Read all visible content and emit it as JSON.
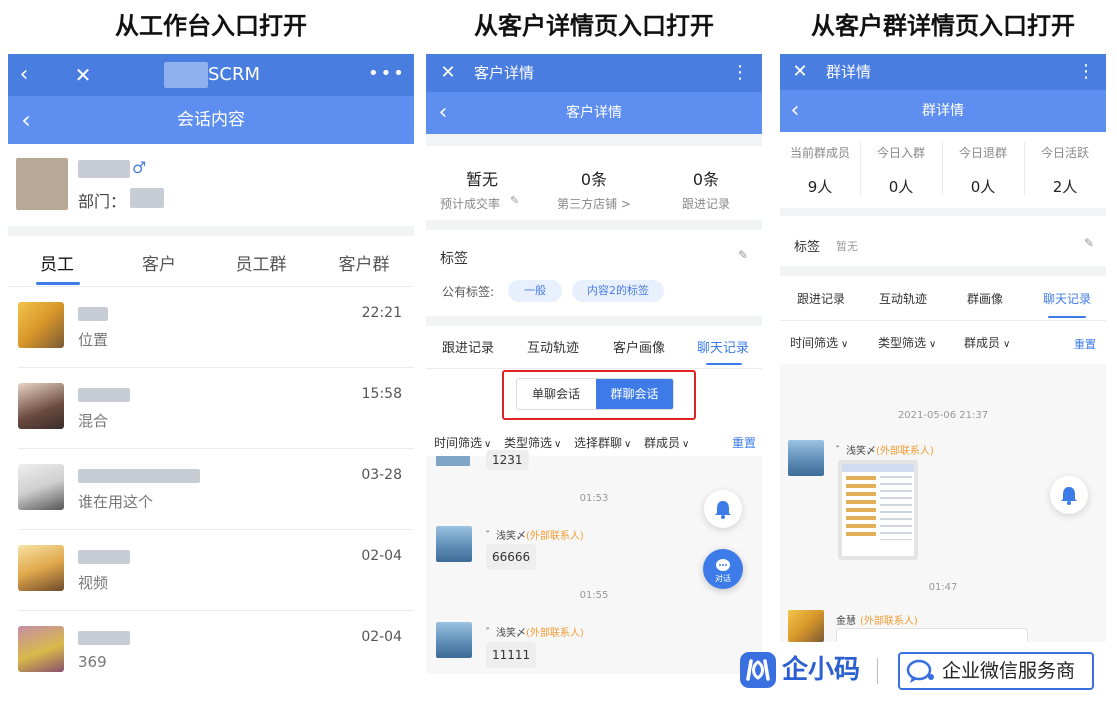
{
  "headings": {
    "h1": "从工作台入口打开",
    "h2": "从客户详情页入口打开",
    "h3": "从客户群详情页入口打开"
  },
  "panel1": {
    "app_title": "SCRM",
    "page_title": "会话内容",
    "dept_label": "部门：",
    "gender_symbol": "♂",
    "tabs": [
      "员工",
      "客户",
      "员工群",
      "客户群"
    ],
    "conversations": [
      {
        "preview": "位置",
        "time": "22:21"
      },
      {
        "preview": "混合",
        "time": "15:58"
      },
      {
        "preview": "谁在用这个",
        "time": "03-28"
      },
      {
        "preview": "视频",
        "time": "02-04"
      },
      {
        "preview": "369",
        "time": "02-04"
      }
    ]
  },
  "panel2": {
    "title_top": "客户详情",
    "title_sub": "客户详情",
    "stats": [
      {
        "value": "暂无",
        "label": "预计成交率"
      },
      {
        "value": "0条",
        "label": "第三方店铺 >"
      },
      {
        "value": "0条",
        "label": "跟进记录"
      }
    ],
    "tags_title": "标签",
    "public_tags_label": "公有标签:",
    "tags": [
      "一般",
      "内容2的标签"
    ],
    "tabs": [
      "跟进记录",
      "互动轨迹",
      "客户画像",
      "聊天记录"
    ],
    "toggle": [
      "单聊会话",
      "群聊会话"
    ],
    "filters": [
      "时间筛选",
      "类型筛选",
      "选择群聊",
      "群成员"
    ],
    "reset": "重置",
    "partial_msg": "1231",
    "messages": [
      {
        "time": "01:53",
        "sender": "゛浅笑〆",
        "tag": "(外部联系人)",
        "text": "66666"
      },
      {
        "time": "01:55",
        "sender": "゛浅笑〆",
        "tag": "(外部联系人)",
        "text": "11111"
      }
    ],
    "chat_fab_label": "对话"
  },
  "panel3": {
    "title_top": "群详情",
    "title_sub": "群详情",
    "stats": [
      {
        "label": "当前群成员",
        "value": "9人"
      },
      {
        "label": "今日入群",
        "value": "0人"
      },
      {
        "label": "今日退群",
        "value": "0人"
      },
      {
        "label": "今日活跃",
        "value": "2人"
      }
    ],
    "tags_title": "标签",
    "tags_value": "暂无",
    "tabs": [
      "跟进记录",
      "互动轨迹",
      "群画像",
      "聊天记录"
    ],
    "filters": [
      "时间筛选",
      "类型筛选",
      "群成员"
    ],
    "reset": "重置",
    "msg1_time": "2021-05-06 21:37",
    "msg1_sender": "゛浅笑〆",
    "msg1_tag": "(外部联系人)",
    "msg2_time": "01:47",
    "msg2_sender": "金慧",
    "msg2_tag": "(外部联系人)"
  },
  "footer": {
    "logo_text": "企小码",
    "badge_text": "企业微信服务商"
  },
  "colors": {
    "primary": "#4a7de0",
    "primary_light": "#5d8ef0",
    "accent_orange": "#f39c33",
    "highlight_red": "#e02424"
  }
}
